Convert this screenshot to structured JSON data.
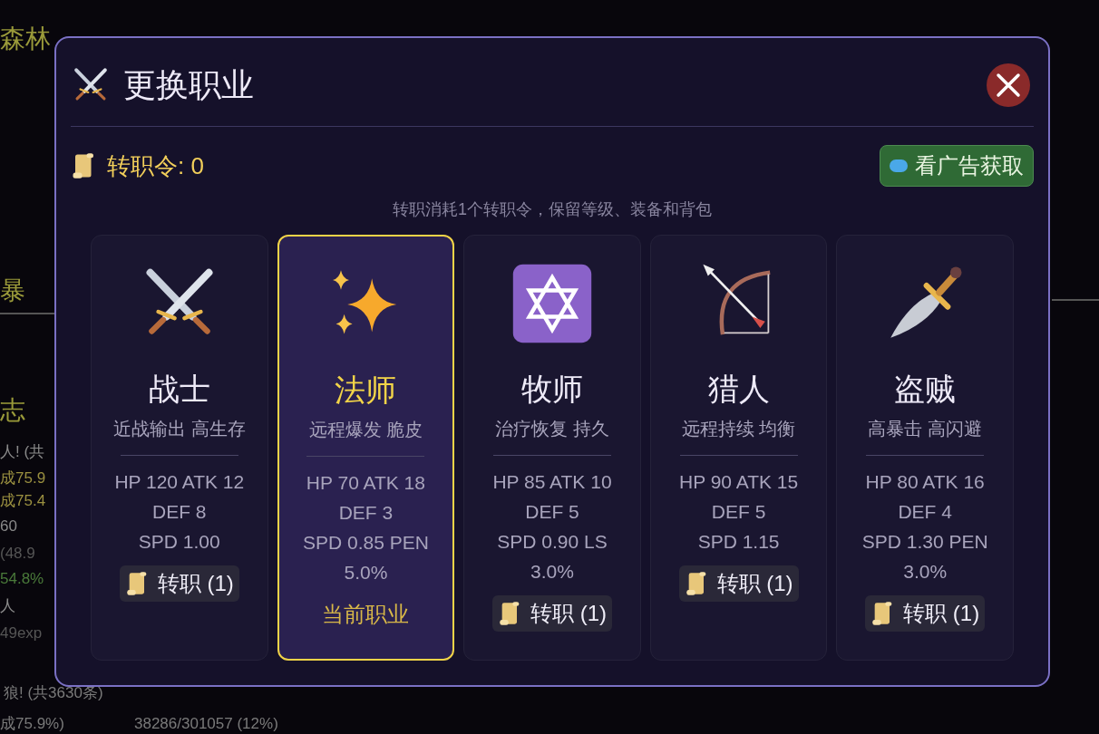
{
  "background": {
    "texts": [
      {
        "kind": "heading",
        "text": "森林"
      },
      {
        "kind": "heading",
        "text": "暴"
      },
      {
        "kind": "heading",
        "text": "志"
      },
      {
        "kind": "line",
        "text": "人! (共"
      },
      {
        "kind": "gold",
        "text": "成75.9"
      },
      {
        "kind": "gold",
        "text": "成75.4"
      },
      {
        "kind": "line",
        "text": "60"
      },
      {
        "kind": "dim",
        "text": "(48.9"
      },
      {
        "kind": "green",
        "text": "54.8%"
      },
      {
        "kind": "line",
        "text": "人"
      },
      {
        "kind": "dim",
        "text": "49exp"
      }
    ],
    "bottom_texts": [
      {
        "text": "狼! (共3630条)"
      },
      {
        "text": "成75.9%)"
      },
      {
        "text": "38286/301057 (12%)"
      }
    ]
  },
  "dialog": {
    "title": "更换职业",
    "tokens": "转职令: 0",
    "ad_button": "看广告获取",
    "note": "转职消耗1个转职令，保留等级、装备和背包",
    "classes": [
      {
        "name": "战士",
        "desc": "近战输出 高生存",
        "stats": [
          "HP 120 ATK 12",
          "DEF 8",
          "SPD 1.00"
        ],
        "selected": false,
        "action": "转职 (1)"
      },
      {
        "name": "法师",
        "desc": "远程爆发 脆皮",
        "stats": [
          "HP 70 ATK 18",
          "DEF 3",
          "SPD 0.85 PEN",
          "5.0%"
        ],
        "selected": true,
        "action": "当前职业"
      },
      {
        "name": "牧师",
        "desc": "治疗恢复 持久",
        "stats": [
          "HP 85 ATK 10",
          "DEF 5",
          "SPD 0.90 LS",
          "3.0%"
        ],
        "selected": false,
        "action": "转职 (1)"
      },
      {
        "name": "猎人",
        "desc": "远程持续 均衡",
        "stats": [
          "HP 90 ATK 15",
          "DEF 5",
          "SPD 1.15"
        ],
        "selected": false,
        "action": "转职 (1)"
      },
      {
        "name": "盗贼",
        "desc": "高暴击 高闪避",
        "stats": [
          "HP 80 ATK 16",
          "DEF 4",
          "SPD 1.30 PEN",
          "3.0%"
        ],
        "selected": false,
        "action": "转职 (1)"
      }
    ]
  }
}
